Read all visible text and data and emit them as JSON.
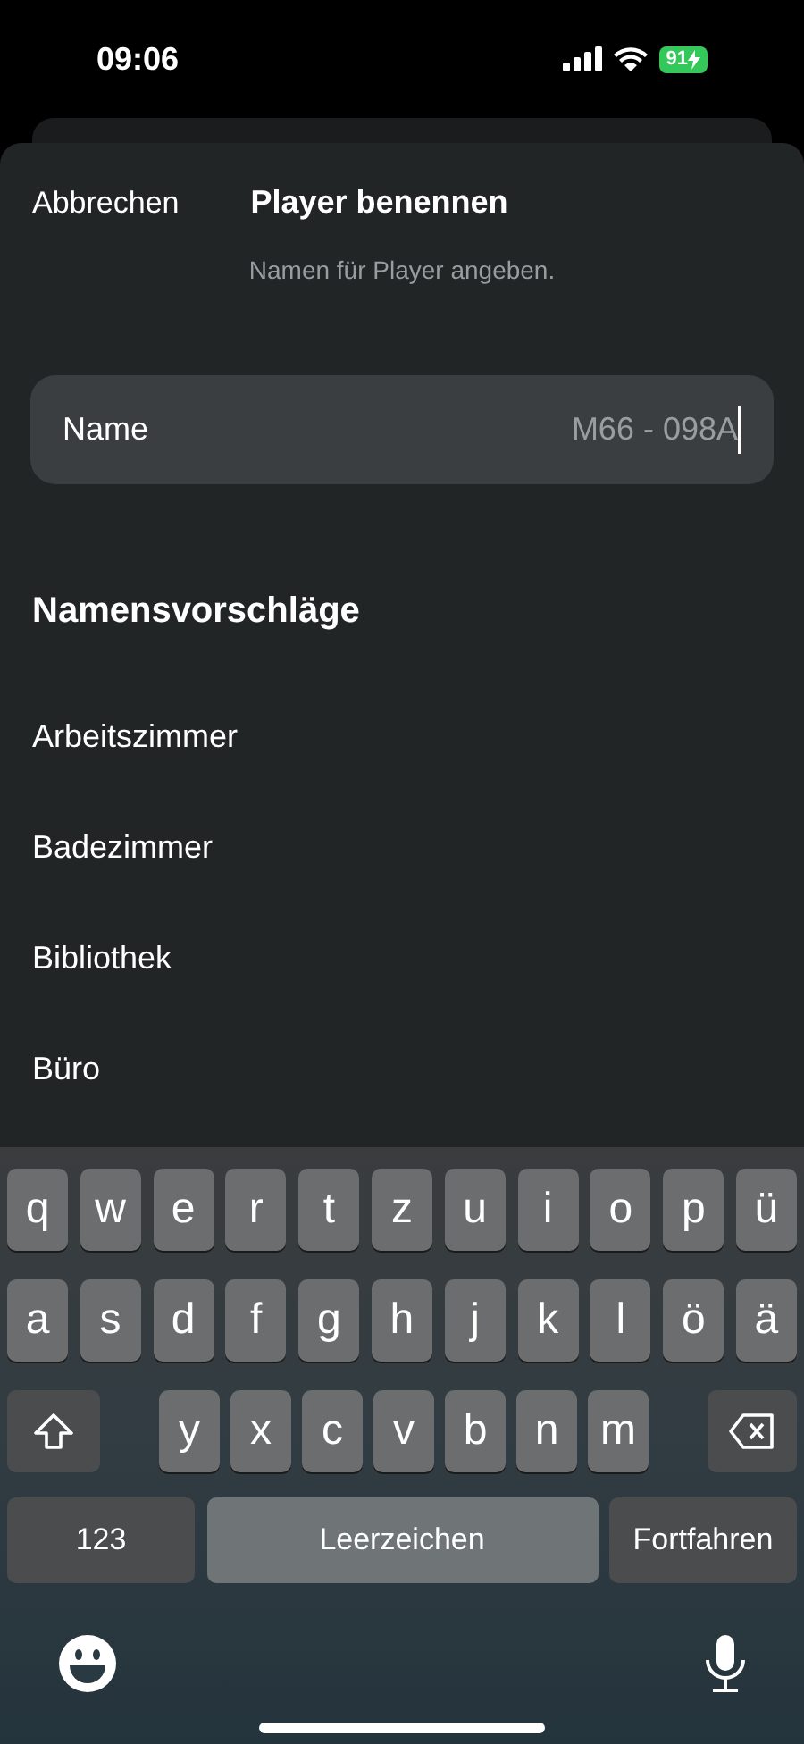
{
  "status_bar": {
    "time": "09:06",
    "battery": "91"
  },
  "header": {
    "cancel": "Abbrechen",
    "title": "Player benennen",
    "subtitle": "Namen für Player angeben."
  },
  "name_field": {
    "label": "Name",
    "value": "M66 - 098A"
  },
  "suggestions": {
    "heading": "Namensvorschläge",
    "items": [
      "Arbeitszimmer",
      "Badezimmer",
      "Bibliothek",
      "Büro"
    ]
  },
  "keyboard": {
    "top_row": [
      "q",
      "w",
      "e",
      "r",
      "t",
      "z",
      "u",
      "i",
      "o",
      "p",
      "ü"
    ],
    "middle_row": [
      "a",
      "s",
      "d",
      "f",
      "g",
      "h",
      "j",
      "k",
      "l",
      "ö",
      "ä"
    ],
    "bottom_row": [
      "y",
      "x",
      "c",
      "v",
      "b",
      "n",
      "m"
    ],
    "numbers_key": "123",
    "space_key": "Leerzeichen",
    "return_key": "Fortfahren"
  }
}
